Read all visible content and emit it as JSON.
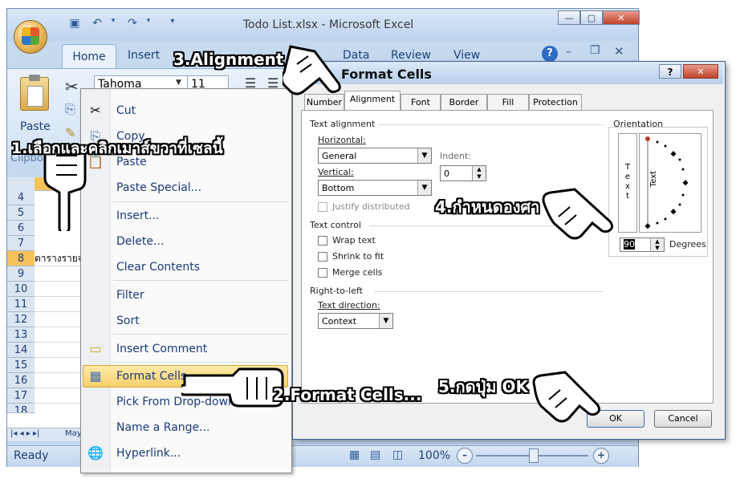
{
  "window": {
    "title": "Todo List.xlsx - Microsoft Excel",
    "min": "—",
    "restore": "▢",
    "close": "✕"
  },
  "ribbon": {
    "tabs": [
      "Home",
      "Insert",
      "Data",
      "Review",
      "View"
    ],
    "paste_label": "Paste",
    "clipboard_group": "Clipbo",
    "font_name": "Tahoma",
    "font_size": "11"
  },
  "sheet": {
    "row_numbers": [
      "4",
      "5",
      "6",
      "7",
      "8",
      "9",
      "10",
      "11",
      "12",
      "13",
      "14",
      "15",
      "16",
      "17",
      "18"
    ],
    "cell_text_row8": "ตารางรายจ่",
    "sheet_tab": "May",
    "status": "Ready",
    "zoom": "100%"
  },
  "context_menu": {
    "items": [
      "Cut",
      "Copy",
      "Paste",
      "Paste Special...",
      "Insert...",
      "Delete...",
      "Clear Contents",
      "Filter",
      "Sort",
      "Insert Comment",
      "Format Cells...",
      "Pick From Drop-down",
      "Name a Range...",
      "Hyperlink..."
    ]
  },
  "dialog": {
    "title": "Format Cells",
    "help": "?",
    "close": "✕",
    "tabs": [
      "Number",
      "Alignment",
      "Font",
      "Border",
      "Fill",
      "Protection"
    ],
    "text_alignment": "Text alignment",
    "horizontal_label": "Horizontal:",
    "horizontal_value": "General",
    "indent_label": "Indent:",
    "indent_value": "0",
    "vertical_label": "Vertical:",
    "vertical_value": "Bottom",
    "justify_distributed": "Justify distributed",
    "text_control": "Text control",
    "wrap_text": "Wrap text",
    "shrink_to_fit": "Shrink to fit",
    "merge_cells": "Merge cells",
    "right_to_left": "Right-to-left",
    "text_direction_label": "Text direction:",
    "text_direction_value": "Context",
    "orientation": "Orientation",
    "orient_vertical_text": "T e x t",
    "orient_rotated_text": "Text",
    "degrees_value": "90",
    "degrees_label": "Degrees",
    "ok": "OK",
    "cancel": "Cancel"
  },
  "annotations": {
    "step1": "1.เลือกและคลิกเมาส์ขวาที่เซลนี้",
    "step2": "2.Format  Cells...",
    "step3": "3.Alignment",
    "step4": "4.กำหนดองศา",
    "step5": "5.กดปุ่ม  OK"
  }
}
